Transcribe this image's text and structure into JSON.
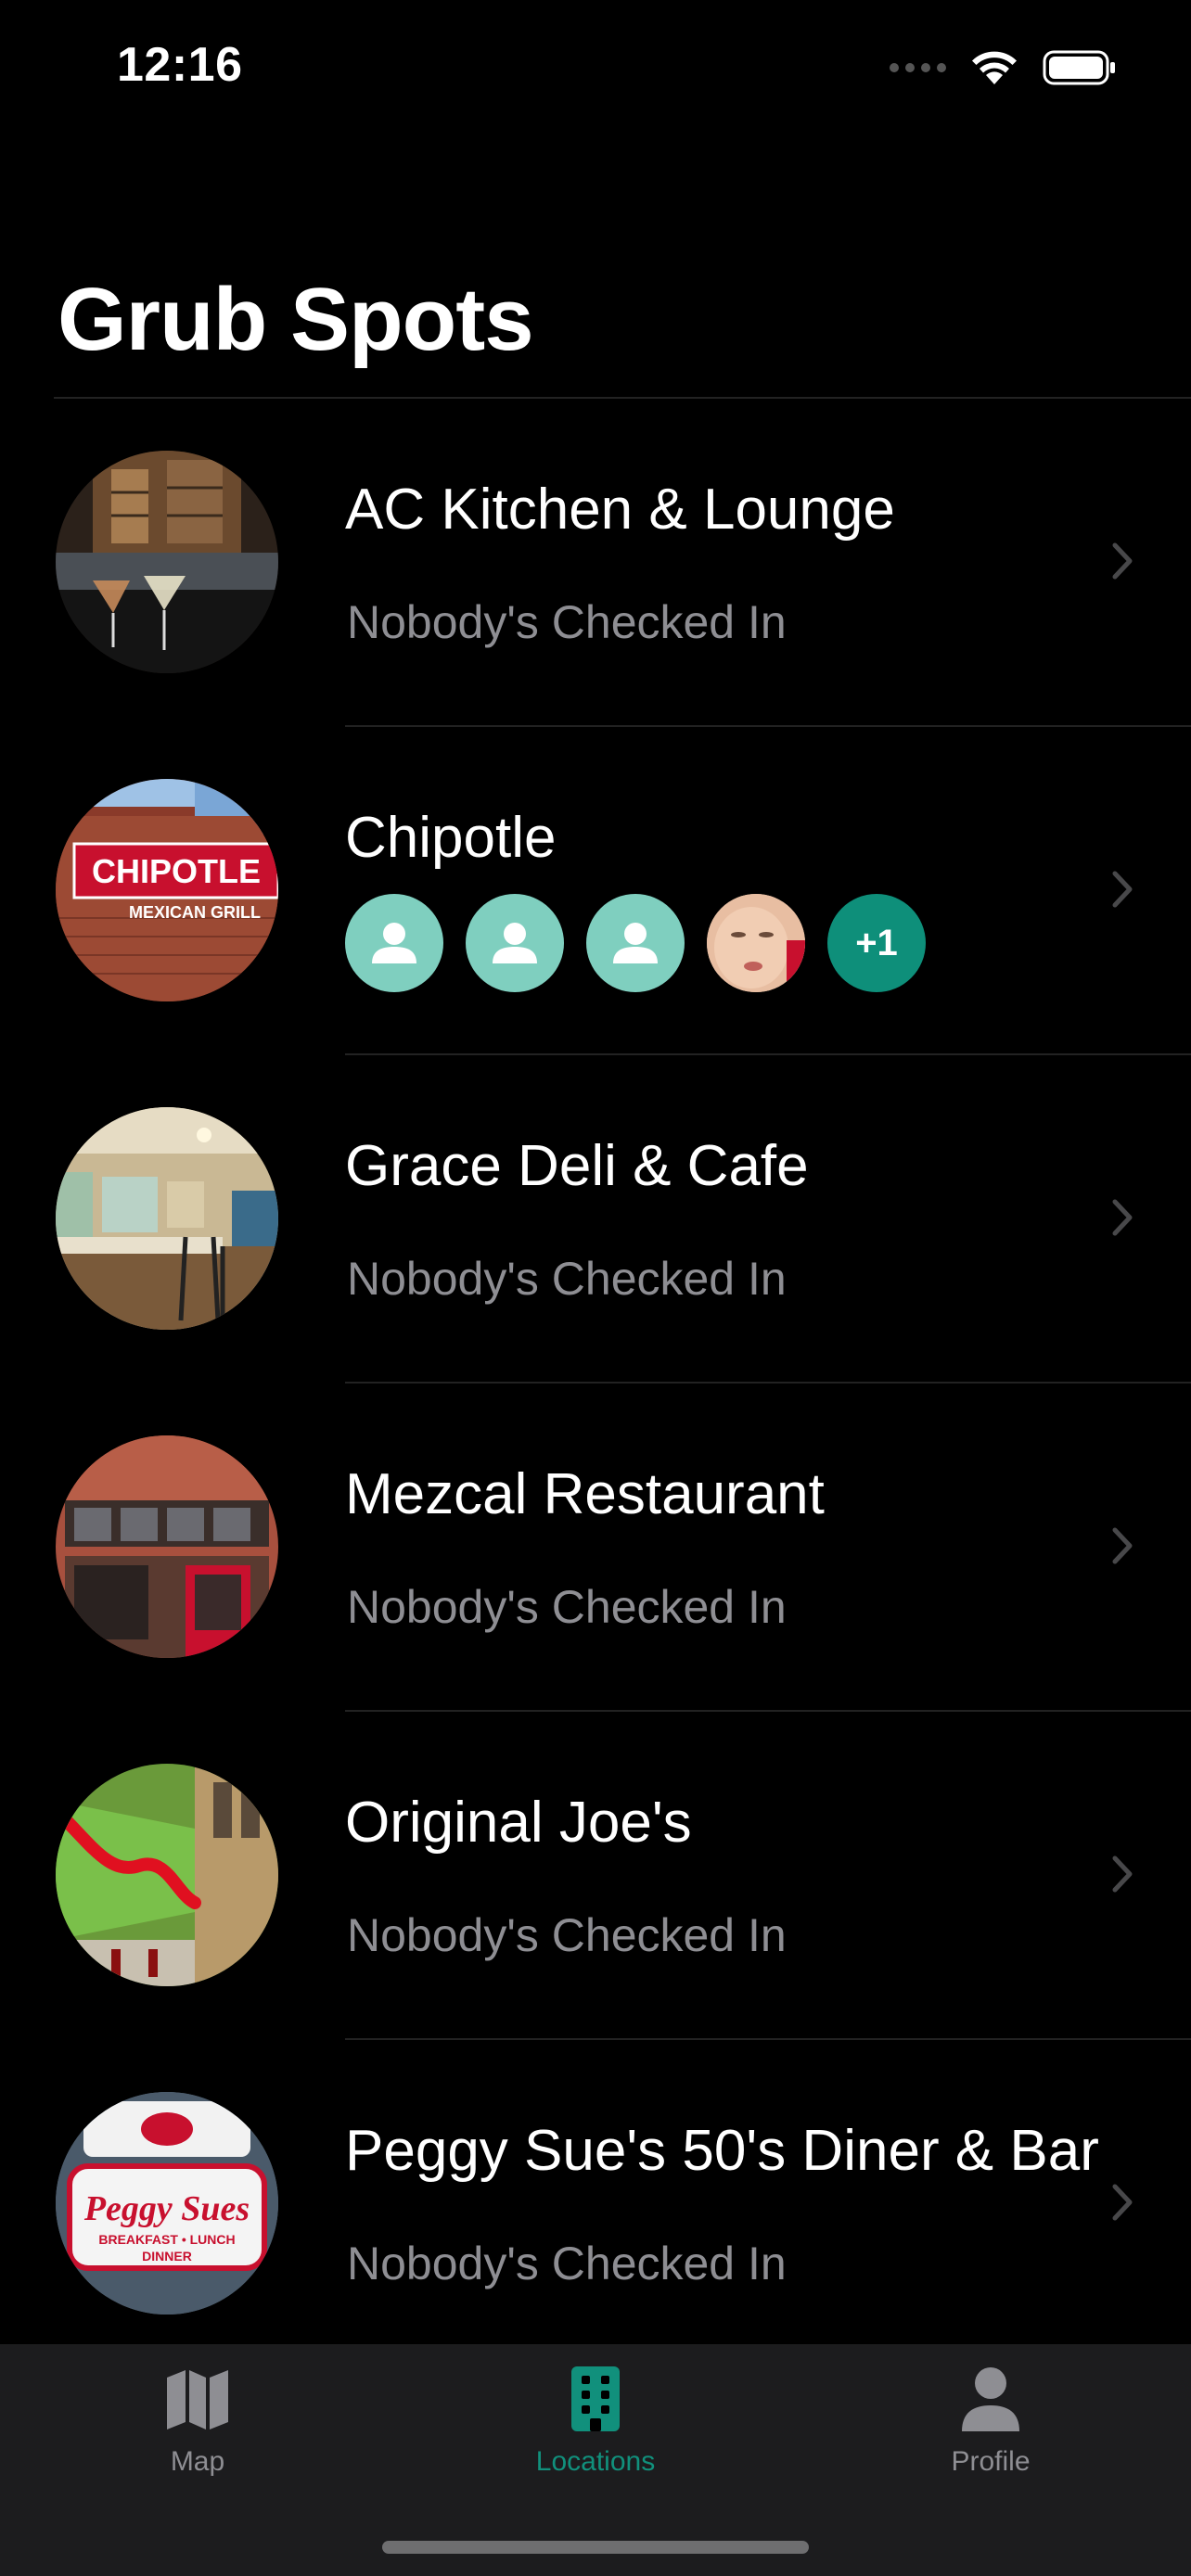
{
  "status_bar": {
    "time": "12:16"
  },
  "header": {
    "title": "Grub Spots"
  },
  "locations": [
    {
      "name": "AC Kitchen & Lounge",
      "status": "Nobody's Checked In"
    },
    {
      "name": "Chipotle",
      "status": "",
      "checked_in": {
        "avatars": [
          "person-icon",
          "person-icon",
          "person-icon",
          "photo"
        ],
        "more": "+1"
      }
    },
    {
      "name": "Grace Deli & Cafe",
      "status": "Nobody's Checked In"
    },
    {
      "name": "Mezcal Restaurant",
      "status": "Nobody's Checked In"
    },
    {
      "name": "Original Joe's",
      "status": "Nobody's Checked In"
    },
    {
      "name": "Peggy Sue's 50's Diner & Bar",
      "status": "Nobody's Checked In"
    }
  ],
  "thumbnail_text": {
    "chipotle_sign": "CHIPOTLE",
    "chipotle_sub": "MEXICAN GRILL",
    "peggy_sign": "Peggy Sues",
    "peggy_sub1": "BREAKFAST • LUNCH",
    "peggy_sub2": "DINNER"
  },
  "tab_bar": {
    "tabs": [
      {
        "label": "Map",
        "icon": "map-icon",
        "active": false
      },
      {
        "label": "Locations",
        "icon": "building-icon",
        "active": true
      },
      {
        "label": "Profile",
        "icon": "person-icon",
        "active": false
      }
    ]
  },
  "colors": {
    "accent": "#11907c",
    "avatar_bg": "#7fcfbf",
    "secondary_text": "#8e8e93",
    "tab_bar_bg": "#1c1c1e"
  }
}
